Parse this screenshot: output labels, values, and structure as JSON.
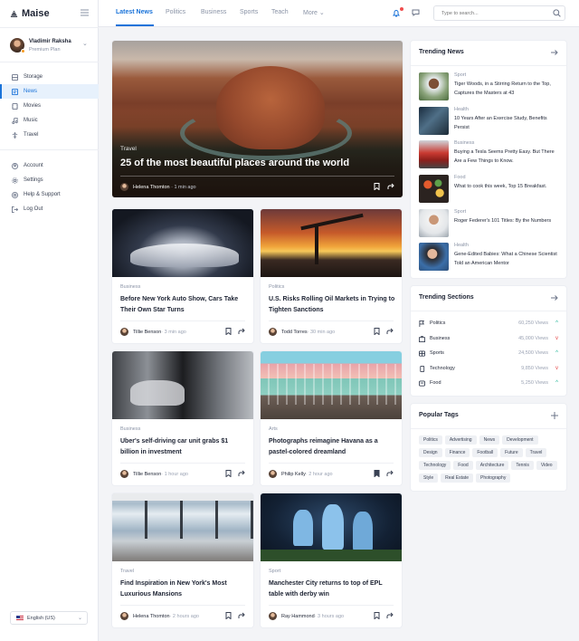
{
  "app": {
    "name": "Maise"
  },
  "user": {
    "name": "Vladimir Raksha",
    "plan": "Premium Plan"
  },
  "sidebar": {
    "main": [
      {
        "label": "Storage",
        "icon": "storage-icon"
      },
      {
        "label": "News",
        "icon": "news-icon",
        "active": true
      },
      {
        "label": "Movies",
        "icon": "movie-icon"
      },
      {
        "label": "Music",
        "icon": "music-icon"
      },
      {
        "label": "Travel",
        "icon": "travel-icon"
      }
    ],
    "account": [
      {
        "label": "Account",
        "icon": "account-icon"
      },
      {
        "label": "Settings",
        "icon": "gear-icon"
      },
      {
        "label": "Help & Support",
        "icon": "help-icon"
      },
      {
        "label": "Log Out",
        "icon": "logout-icon"
      }
    ],
    "language": "English (US)"
  },
  "topnav": {
    "tabs": [
      "Latest News",
      "Politics",
      "Business",
      "Sports",
      "Teach",
      "More"
    ],
    "active_tab": "Latest News",
    "search_placeholder": "Type to search..."
  },
  "featured": {
    "category": "Travel",
    "title": "25 of the most beautiful places around the world",
    "author": "Helena Thomton",
    "time": "· 1 min ago"
  },
  "articles": [
    {
      "category": "Business",
      "title": "Before New York Auto Show, Cars Take Their Own Star Turns",
      "author": "Tillie Benson",
      "time": " · 3 min ago"
    },
    {
      "category": "Politics",
      "title": "U.S. Risks Rolling Oil Markets in Trying to Tighten Sanctions",
      "author": "Todd Torres",
      "time": " · 30 min ago"
    },
    {
      "category": "Business",
      "title": "Uber's self-driving car unit grabs $1 billion in investment",
      "author": "Tillie Benson",
      "time": " · 1 hour ago"
    },
    {
      "category": "Arts",
      "title": "Photographs reimagine Havana as a pastel-colored dreamland",
      "author": "Philip Kelly",
      "time": " · 2 hour ago"
    },
    {
      "category": "Travel",
      "title": "Find Inspiration in New York's Most Luxurious Mansions",
      "author": "Helena Thomton",
      "time": " · 2 hours ago"
    },
    {
      "category": "Sport",
      "title": "Manchester City returns to top of EPL table with derby win",
      "author": "Ray Hammond",
      "time": " · 3 hours ago"
    }
  ],
  "trending_news": {
    "title": "Trending News",
    "items": [
      {
        "category": "Sport",
        "text": "Tiger Woods, in a Stirring Return to the Top, Captures the Masters at 43"
      },
      {
        "category": "Health",
        "text": "10 Years After an Exercise Study, Benefits Persist"
      },
      {
        "category": "Business",
        "text": "Buying a Tesla Seems Pretty Easy. But There Are a Few Things to Know."
      },
      {
        "category": "Food",
        "text": "What to cook this week, Top 15 Breakfast."
      },
      {
        "category": "Sport",
        "text": "Roger Federer's 101 Titles: By the Numbers"
      },
      {
        "category": "Health",
        "text": "Gene-Edited Babies: What a Chinese Scientist Told an American Mentor"
      }
    ]
  },
  "trending_sections": {
    "title": "Trending Sections",
    "items": [
      {
        "label": "Politics",
        "views": "60,250 Views",
        "trend": "up",
        "icon": "flag-icon"
      },
      {
        "label": "Business",
        "views": "45,000 Views",
        "trend": "down",
        "icon": "briefcase-icon"
      },
      {
        "label": "Sports",
        "views": "24,500 Views",
        "trend": "up",
        "icon": "ball-icon"
      },
      {
        "label": "Technology",
        "views": "9,850 Views",
        "trend": "down",
        "icon": "phone-icon"
      },
      {
        "label": "Food",
        "views": "5,250 Views",
        "trend": "up",
        "icon": "food-icon"
      }
    ]
  },
  "popular_tags": {
    "title": "Popular Tags",
    "tags": [
      "Politics",
      "Advertising",
      "News",
      "Development",
      "Design",
      "Finance",
      "Football",
      "Future",
      "Travel",
      "Technology",
      "Food",
      "Architecture",
      "Tennis",
      "Video",
      "Style",
      "Real Estate",
      "Photography"
    ]
  },
  "colors": {
    "accent": "#1a73d9",
    "up": "#1ab394",
    "down": "#e54545",
    "background": "#f3f4f7"
  }
}
